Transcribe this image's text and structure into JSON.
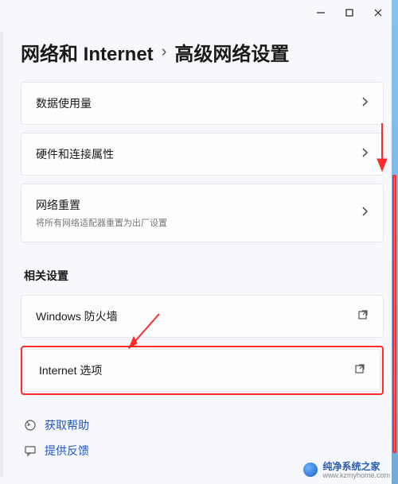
{
  "breadcrumb": {
    "parent": "网络和 Internet",
    "separator": "›",
    "current": "高级网络设置"
  },
  "items": {
    "data_usage": {
      "title": "数据使用量"
    },
    "hw_props": {
      "title": "硬件和连接属性"
    },
    "net_reset": {
      "title": "网络重置",
      "sub": "将所有网络适配器重置为出厂设置"
    }
  },
  "related": {
    "label": "相关设置",
    "firewall": {
      "title": "Windows 防火墙"
    },
    "inet_opts": {
      "title": "Internet 选项"
    }
  },
  "footer": {
    "help": "获取帮助",
    "feedback": "提供反馈"
  },
  "watermark": {
    "main": "纯净系统之家",
    "sub": "www.kzmyhome.com"
  }
}
